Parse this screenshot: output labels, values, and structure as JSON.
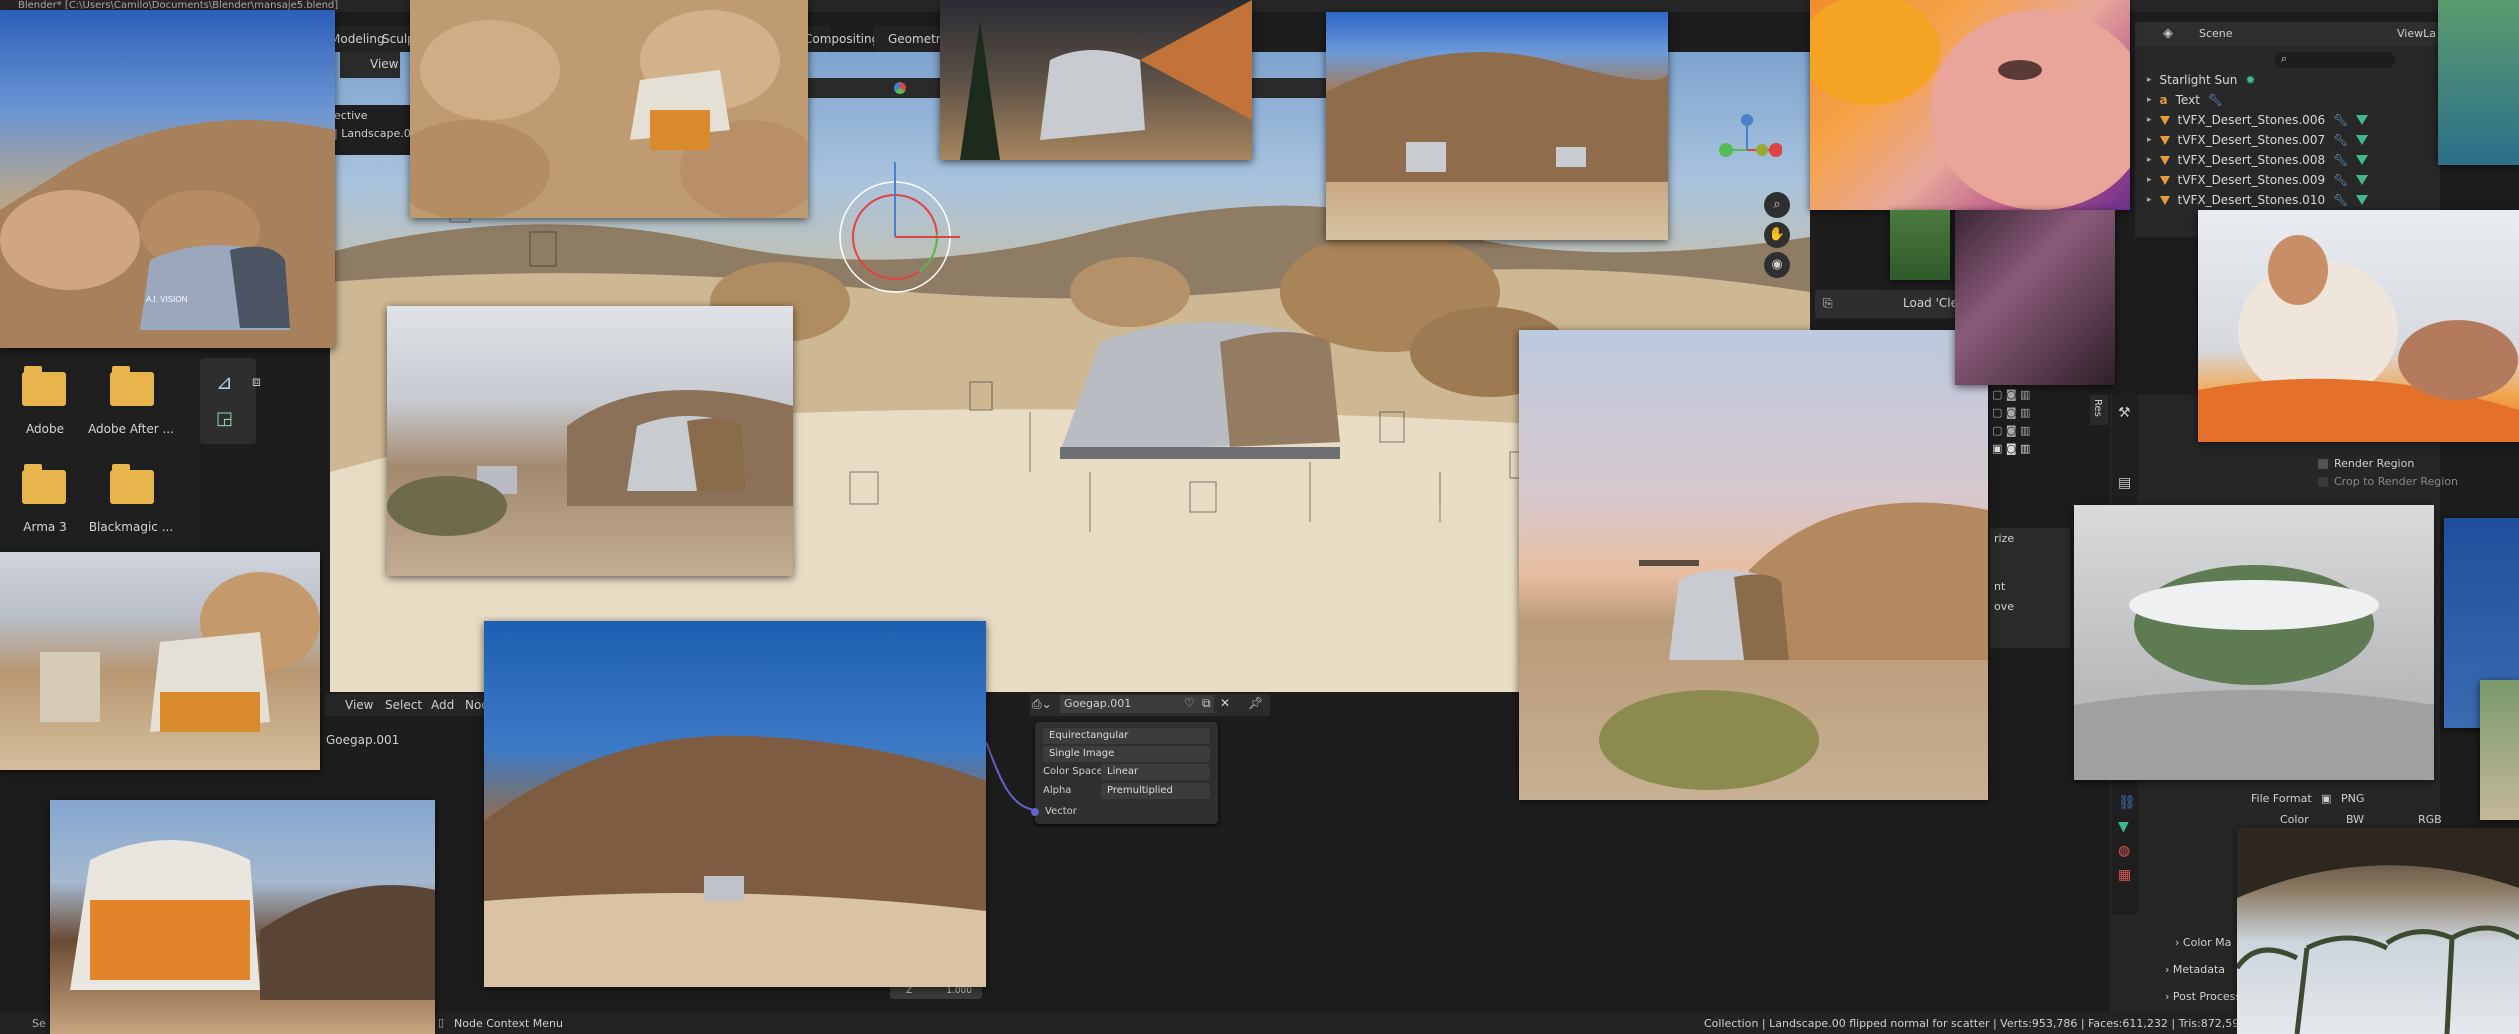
{
  "window_title": "Blender* [C:\\Users\\Camilo\\Documents\\Blender\\mansaje5.blend]",
  "top_menu": [
    "Modeling",
    "Sculpt",
    "Compositing",
    "Geometry"
  ],
  "viewport_header": {
    "view_label": "View"
  },
  "outliner_partial": {
    "line1": "ective",
    "line2": "| Landscape.0"
  },
  "outliner": {
    "scene_label": "Scene",
    "view_layer_label": "ViewLa",
    "search_placeholder": "",
    "items": [
      {
        "label": "Starlight Sun",
        "kind": "light"
      },
      {
        "label": "Text",
        "kind": "text"
      },
      {
        "label": "tVFX_Desert_Stones.006",
        "kind": "mesh"
      },
      {
        "label": "tVFX_Desert_Stones.007",
        "kind": "mesh"
      },
      {
        "label": "tVFX_Desert_Stones.008",
        "kind": "mesh"
      },
      {
        "label": "tVFX_Desert_Stones.009",
        "kind": "mesh"
      },
      {
        "label": "tVFX_Desert_Stones.010",
        "kind": "mesh"
      }
    ]
  },
  "file_browser": {
    "folders": [
      {
        "label": "Adobe"
      },
      {
        "label": "Adobe After ..."
      },
      {
        "label": "Arma 3"
      },
      {
        "label": "Blackmagic ..."
      }
    ]
  },
  "node_editor": {
    "menu": [
      "View",
      "Select",
      "Add",
      "Noc"
    ],
    "image_name": "Goegap.001",
    "breadcrumb": "Goegap.001",
    "node": {
      "projection": "Equirectangular",
      "source": "Single Image",
      "color_space_label": "Color Space",
      "color_space_value": "Linear",
      "alpha_label": "Alpha",
      "alpha_value": "Premultiplied",
      "socket_label": "Vector"
    },
    "z_label": "Z",
    "z_value": "1.000"
  },
  "properties": {
    "render_region": "Render Region",
    "crop_region": "Crop to Render Region",
    "file_format_label": "File Format",
    "file_format_value": "PNG",
    "color_label": "Color",
    "color_options": [
      "BW",
      "RGB"
    ],
    "color_management": "Color Ma",
    "metadata": "Metadata",
    "post_processing": "Post Process",
    "load_label": "Load 'Cle",
    "side_tab": "Res",
    "left_frag": [
      "rize",
      "nt",
      "ove"
    ]
  },
  "status_bar": {
    "left": "Node Context Menu",
    "left_small": "Se",
    "right": "Collection | Landscape.00 flipped normal for scatter | Verts:953,786 | Faces:611,232 | Tris:872,592 | Obje"
  },
  "photo_labels": {
    "cabin_text": "A.I. VISION"
  },
  "colors": {
    "accent_blue": "#4a7fc9",
    "mesh_orange": "#e69a3c",
    "vertex_green": "#3fb88a",
    "panel_bg": "#2c2c2c",
    "editor_bg": "#1d1d1d"
  }
}
